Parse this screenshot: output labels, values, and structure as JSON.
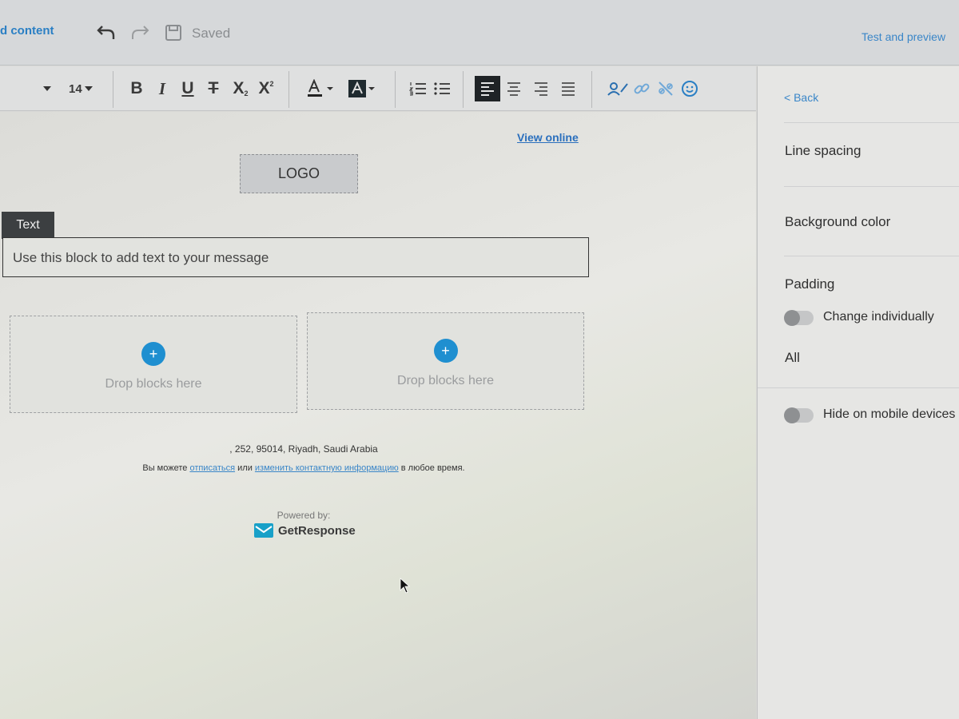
{
  "header": {
    "back_label": "d content",
    "saved_label": "Saved",
    "preview_label": "Test and preview"
  },
  "toolbar": {
    "font_size": "14",
    "bold": "B",
    "italic": "I",
    "underline": "U",
    "strikethrough": "T",
    "subscript": "X",
    "superscript": "X"
  },
  "canvas": {
    "view_online": "View online",
    "logo": "LOGO",
    "text_tab": "Text",
    "text_placeholder": "Use this block to add text to your message",
    "drop_zones": [
      "Drop blocks here",
      "Drop blocks here"
    ],
    "address": ", 252, 95014, Riyadh, Saudi Arabia",
    "unsub_prefix": "Вы можете",
    "unsub_link1": "отписаться",
    "unsub_mid": "или",
    "unsub_link2": "изменить контактную информацию",
    "unsub_suffix": "в любое время.",
    "powered_by": "Powered by:",
    "brand": "GetResponse"
  },
  "panel": {
    "back": "< Back",
    "line_spacing": "Line spacing",
    "background_color": "Background color",
    "padding": "Padding",
    "change_individually": "Change individually",
    "all": "All",
    "hide_mobile": "Hide on mobile devices"
  },
  "colors": {
    "accent": "#2a7fc4",
    "plus_button": "#1f8fd0"
  }
}
